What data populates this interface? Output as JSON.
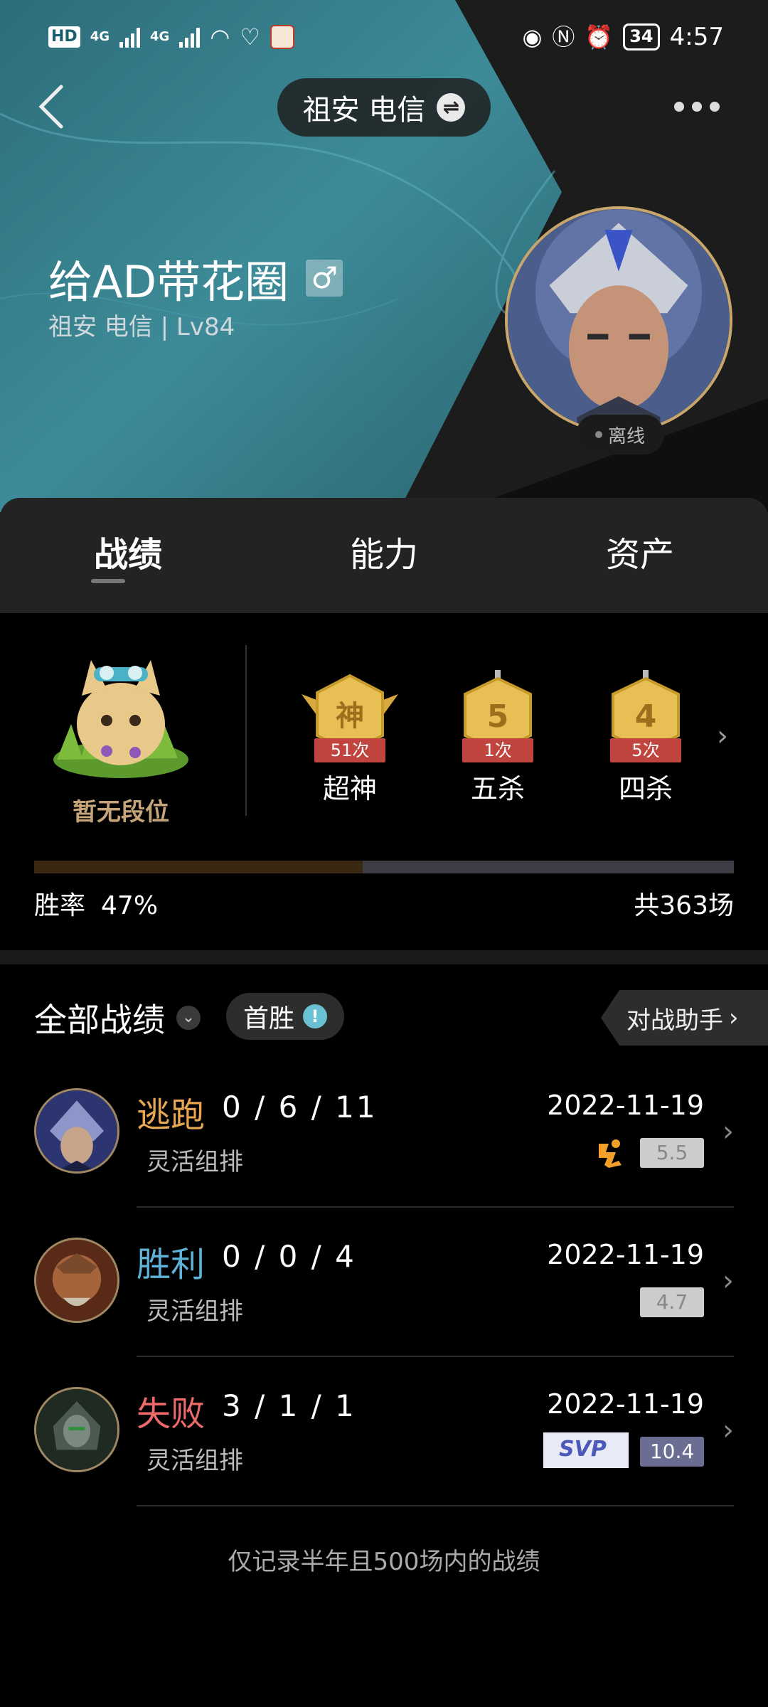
{
  "status_bar": {
    "hd_label": "HD",
    "sim_label": "2",
    "net1": "4G",
    "net2": "4G",
    "battery": "34",
    "time": "4:57"
  },
  "header": {
    "server": "祖安 电信",
    "player_name": "给AD带花圈",
    "gender_symbol": "♂",
    "server_level": "祖安 电信 | Lv84",
    "status": "离线"
  },
  "tabs": [
    {
      "label": "战绩",
      "active": true
    },
    {
      "label": "能力",
      "active": false
    },
    {
      "label": "资产",
      "active": false
    }
  ],
  "stats": {
    "rank_label": "暂无段位",
    "medals": [
      {
        "glyph": "神",
        "count": "51次",
        "label": "超神"
      },
      {
        "glyph": "5",
        "count": "1次",
        "label": "五杀"
      },
      {
        "glyph": "4",
        "count": "5次",
        "label": "四杀"
      }
    ],
    "win_rate_label": "胜率",
    "win_rate_value": "47%",
    "win_rate_fraction": 0.47,
    "total_games": "共363场"
  },
  "match_list": {
    "filter_label": "全部战绩",
    "first_win_label": "首胜",
    "assistant_label": "对战助手",
    "matches": [
      {
        "result": "逃跑",
        "result_color": "#e8a653",
        "kda": "0 / 6 / 11",
        "mode": "灵活组排",
        "date": "2022-11-19",
        "score": "5.5",
        "badge": "flee"
      },
      {
        "result": "胜利",
        "result_color": "#5fb3d9",
        "kda": "0 / 0 / 4",
        "mode": "灵活组排",
        "date": "2022-11-19",
        "score": "4.7",
        "badge": ""
      },
      {
        "result": "失败",
        "result_color": "#ec6a6a",
        "kda": "3 / 1 / 1",
        "mode": "灵活组排",
        "date": "2022-11-19",
        "score": "10.4",
        "badge": "svp"
      }
    ],
    "svp_label": "SVP",
    "footer": "仅记录半年且500场内的战绩"
  }
}
